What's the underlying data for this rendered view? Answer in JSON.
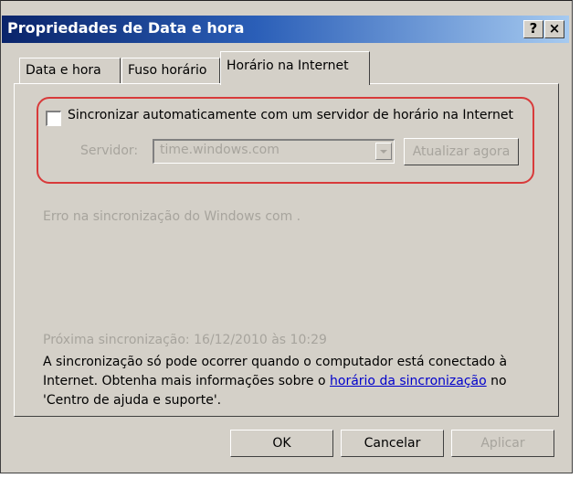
{
  "window": {
    "title": "Propriedades de Data e hora"
  },
  "title_buttons": {
    "help": "?",
    "close": "×"
  },
  "tabs": [
    {
      "label": "Data e hora"
    },
    {
      "label": "Fuso horário"
    },
    {
      "label": "Horário na Internet"
    }
  ],
  "sync": {
    "checkbox_label": "Sincronizar automaticamente com um servidor de horário na Internet",
    "checked": false,
    "server_label": "Servidor:",
    "server_value": "time.windows.com",
    "update_button": "Atualizar agora"
  },
  "status": {
    "error": "Erro na sincronização do Windows com .",
    "next_sync": "Próxima sincronização: 16/12/2010 às 10:29"
  },
  "info": {
    "line1": "A sincronização só pode ocorrer quando o computador está conectado à",
    "line2_prefix": "Internet. Obtenha mais informações sobre o ",
    "line2_link": "horário da sincronização",
    "line2_suffix": " no",
    "line3": "'Centro de ajuda e suporte'."
  },
  "buttons": {
    "ok": "OK",
    "cancel": "Cancelar",
    "apply": "Aplicar"
  },
  "colors": {
    "titlebar_start": "#0a246a",
    "titlebar_end": "#a6caf0",
    "highlight": "#d83a3a",
    "face": "#d4d0c8"
  }
}
